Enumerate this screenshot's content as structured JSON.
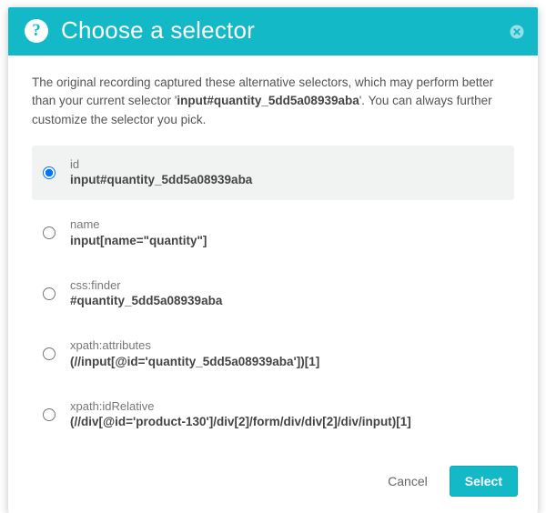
{
  "header": {
    "title": "Choose a selector",
    "help_icon": "help-circle-icon",
    "close_icon": "close-icon"
  },
  "intro": {
    "before": "The original recording captured these alternative selectors, which may perform better than your current selector '",
    "selector": "input#quantity_5dd5a08939aba",
    "after": "'. You can always further customize the selector you pick."
  },
  "options": [
    {
      "label": "id",
      "value": "input#quantity_5dd5a08939aba",
      "selected": true
    },
    {
      "label": "name",
      "value": "input[name=\"quantity\"]",
      "selected": false
    },
    {
      "label": "css:finder",
      "value": "#quantity_5dd5a08939aba",
      "selected": false
    },
    {
      "label": "xpath:attributes",
      "value": "(//input[@id='quantity_5dd5a08939aba'])[1]",
      "selected": false
    },
    {
      "label": "xpath:idRelative",
      "value": "(//div[@id='product-130']/div[2]/form/div/div[2]/div/input)[1]",
      "selected": false
    }
  ],
  "footer": {
    "cancel": "Cancel",
    "select": "Select"
  }
}
